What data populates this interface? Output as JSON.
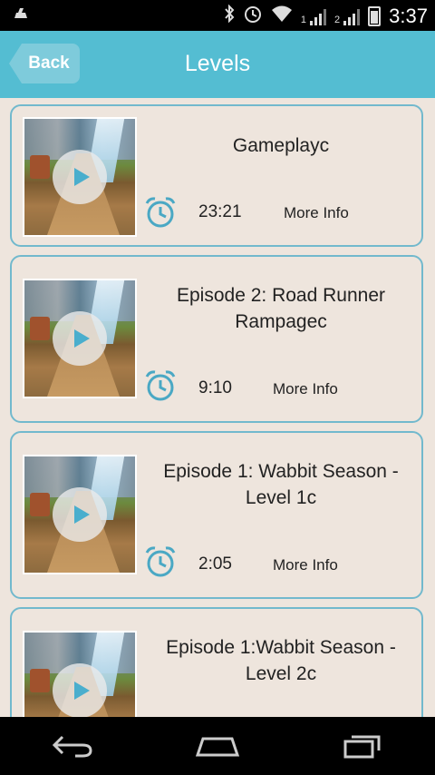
{
  "status_bar": {
    "usb_icon": "usb-icon",
    "bluetooth_icon": "bluetooth-icon",
    "alarm_icon": "alarm-icon",
    "wifi_icon": "wifi-icon",
    "sim1_label": "1",
    "sim2_label": "2",
    "time": "3:37"
  },
  "header": {
    "back_label": "Back",
    "title": "Levels"
  },
  "levels": [
    {
      "title": "Gameplayc",
      "duration": "23:21",
      "more_label": "More Info"
    },
    {
      "title": "Episode 2: Road Runner Rampagec",
      "duration": "9:10",
      "more_label": "More Info"
    },
    {
      "title": "Episode 1: Wabbit Season - Level 1c",
      "duration": "2:05",
      "more_label": "More Info"
    },
    {
      "title": "Episode 1:Wabbit Season - Level 2c",
      "duration": "",
      "more_label": ""
    }
  ],
  "nav": {
    "back_icon": "back-arrow-icon",
    "home_icon": "home-icon",
    "recents_icon": "recent-apps-icon"
  },
  "colors": {
    "accent": "#54bdd2",
    "card_border": "#72b9cd",
    "background": "#eee5dd"
  }
}
